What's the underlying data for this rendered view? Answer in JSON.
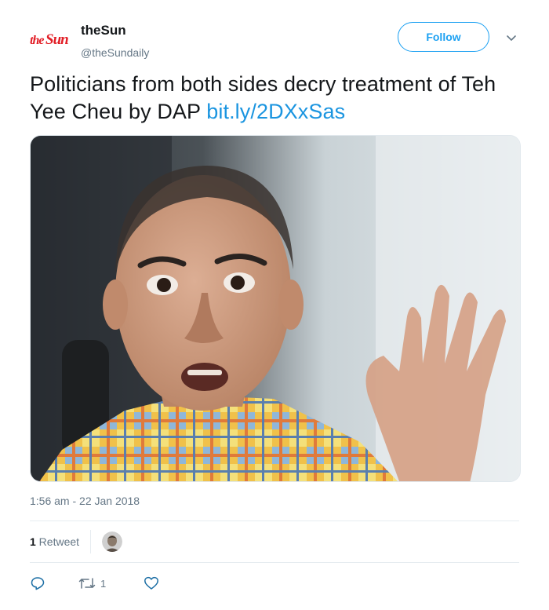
{
  "author": {
    "logo_text": "theSun",
    "name": "theSun",
    "handle": "@theSundaily"
  },
  "follow_label": "Follow",
  "tweet": {
    "text": "Politicians from both sides decry treatment of Teh Yee Cheu by DAP ",
    "link": "bit.ly/2DXxSas"
  },
  "timestamp": "1:56 am - 22 Jan 2018",
  "stats": {
    "retweet_count": "1",
    "retweet_label": " Retweet"
  },
  "actions": {
    "retweet_count": "1"
  },
  "colors": {
    "accent": "#1da1f2",
    "link": "#1b95e0",
    "muted": "#657786",
    "logo_red": "#e21e26"
  }
}
